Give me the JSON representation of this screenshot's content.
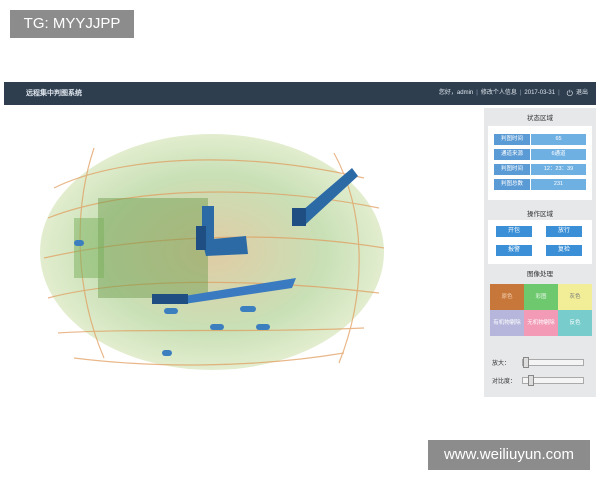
{
  "watermarks": {
    "top_left": "TG: MYYJJPP",
    "bottom_right": "www.weiliuyun.com"
  },
  "app": {
    "title": "远程集中判图系统",
    "nav": {
      "greeting": "您好，admin",
      "profile": "修改个人信息",
      "date": "2017-03-31",
      "logout": "退出"
    }
  },
  "status": {
    "title": "状态区域",
    "rows": [
      {
        "label": "判图时间",
        "value": "65"
      },
      {
        "label": "通道来源",
        "value": "6通道"
      },
      {
        "label": "判图时间",
        "value": "12：23：39"
      },
      {
        "label": "判图总数",
        "value": "231"
      }
    ]
  },
  "ops": {
    "title": "操作区域",
    "buttons": [
      "开包",
      "放行",
      "报警",
      "复检"
    ]
  },
  "imaging": {
    "title": "图像处理",
    "filters": [
      {
        "label": "原色",
        "bg": "#c8773a",
        "fg": "#f4d4b8"
      },
      {
        "label": "彩图",
        "bg": "#6ec96e",
        "fg": "#e8f6e8"
      },
      {
        "label": "灰色",
        "bg": "#f1ee97",
        "fg": "#777777"
      },
      {
        "label": "有机物剔除",
        "bg": "#b6b6dc",
        "fg": "#ffffff"
      },
      {
        "label": "无机物剔除",
        "bg": "#f29ab6",
        "fg": "#ffffff"
      },
      {
        "label": "反色",
        "bg": "#79cccc",
        "fg": "#ffffff"
      }
    ],
    "zoom_label": "放大：",
    "contrast_label": "对比度：",
    "zoom_level": 0.0,
    "contrast_level": 0.1
  },
  "colors": {
    "topbar": "#2e3e4e",
    "panel": "#e6e8ea",
    "button": "#3a8fd6",
    "status_key": "#5b9bd5",
    "status_value": "#6fb0e3"
  }
}
